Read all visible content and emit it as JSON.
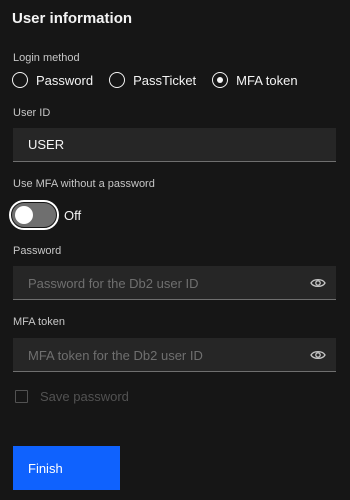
{
  "title": "User information",
  "login_method": {
    "label": "Login method",
    "options": [
      {
        "label": "Password",
        "checked": false
      },
      {
        "label": "PassTicket",
        "checked": false
      },
      {
        "label": "MFA token",
        "checked": true
      }
    ]
  },
  "user_id": {
    "label": "User ID",
    "value": "USER"
  },
  "mfa_toggle": {
    "label": "Use MFA without a password",
    "state": "Off"
  },
  "password": {
    "label": "Password",
    "placeholder": "Password for the Db2 user ID",
    "icon": "eye-icon"
  },
  "mfa_token": {
    "label": "MFA token",
    "placeholder": "MFA token for the Db2 user ID",
    "icon": "eye-icon"
  },
  "save_password": {
    "label": "Save password",
    "checked": false
  },
  "finish_button": {
    "label": "Finish"
  },
  "colors": {
    "background": "#161616",
    "field": "#262626",
    "primary": "#0f62fe"
  }
}
